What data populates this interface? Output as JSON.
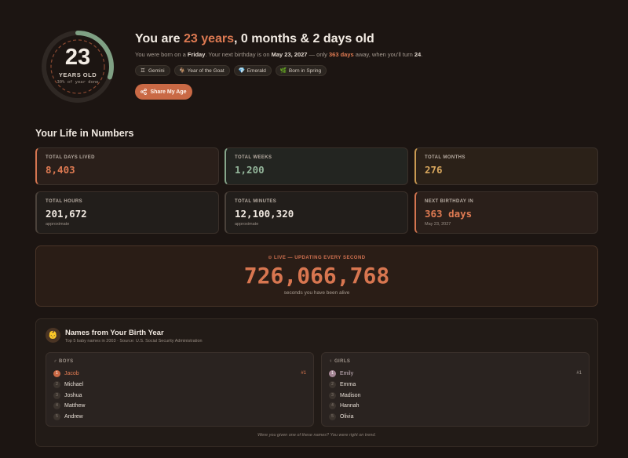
{
  "hero": {
    "age_number": "23",
    "age_label": "YEARS OLD",
    "year_progress_text": "30% of year done",
    "year_progress_fraction": 0.3,
    "title_prefix": "You are ",
    "title_years": "23 years",
    "title_suffix": ", 0 months & 2 days old",
    "sub_1": "You were born on a ",
    "sub_day": "Friday",
    "sub_2": ". Your next birthday is on ",
    "sub_date": "May 23, 2027",
    "sub_3": " — only ",
    "sub_days": "363 days",
    "sub_4": " away, when you'll turn ",
    "sub_turn": "24",
    "sub_5": ".",
    "tags": [
      {
        "icon": "gemini-icon",
        "glyph": "♊",
        "label": "Gemini"
      },
      {
        "icon": "goat-icon",
        "glyph": "🐐",
        "label": "Year of the Goat"
      },
      {
        "icon": "gem-icon",
        "glyph": "💎",
        "label": "Emerald"
      },
      {
        "icon": "leaf-icon",
        "glyph": "🌿",
        "label": "Born in Spring"
      }
    ],
    "share_label": "Share My Age"
  },
  "section_title": "Your Life in Numbers",
  "stats": [
    {
      "label": "TOTAL DAYS LIVED",
      "value": "8,403",
      "note": ""
    },
    {
      "label": "TOTAL WEEKS",
      "value": "1,200",
      "note": ""
    },
    {
      "label": "TOTAL MONTHS",
      "value": "276",
      "note": ""
    },
    {
      "label": "TOTAL HOURS",
      "value": "201,672",
      "note": "approximate"
    },
    {
      "label": "TOTAL MINUTES",
      "value": "12,100,320",
      "note": "approximate"
    },
    {
      "label": "NEXT BIRTHDAY IN",
      "value": "363 days",
      "note": "May 23, 2027"
    }
  ],
  "live": {
    "label": "⊙ LIVE — UPDATING EVERY SECOND",
    "value": "726,066,768",
    "sub": "seconds you have been alive"
  },
  "names": {
    "title": "Names from Your Birth Year",
    "subtitle": "Top 5 baby names in 2003 · Source: U.S. Social Security Administration",
    "boys_header": "♂ BOYS",
    "girls_header": "♀ GIRLS",
    "boys": [
      "Jacob",
      "Michael",
      "Joshua",
      "Matthew",
      "Andrew"
    ],
    "girls": [
      "Emily",
      "Emma",
      "Madison",
      "Hannah",
      "Olivia"
    ],
    "top_badge": "#1",
    "footer": "Were you given one of these names? You were right on trend."
  },
  "colors": {
    "accent": "#de7a52",
    "green": "#93b59a",
    "gold": "#d7a65d",
    "background": "#1c1512"
  }
}
